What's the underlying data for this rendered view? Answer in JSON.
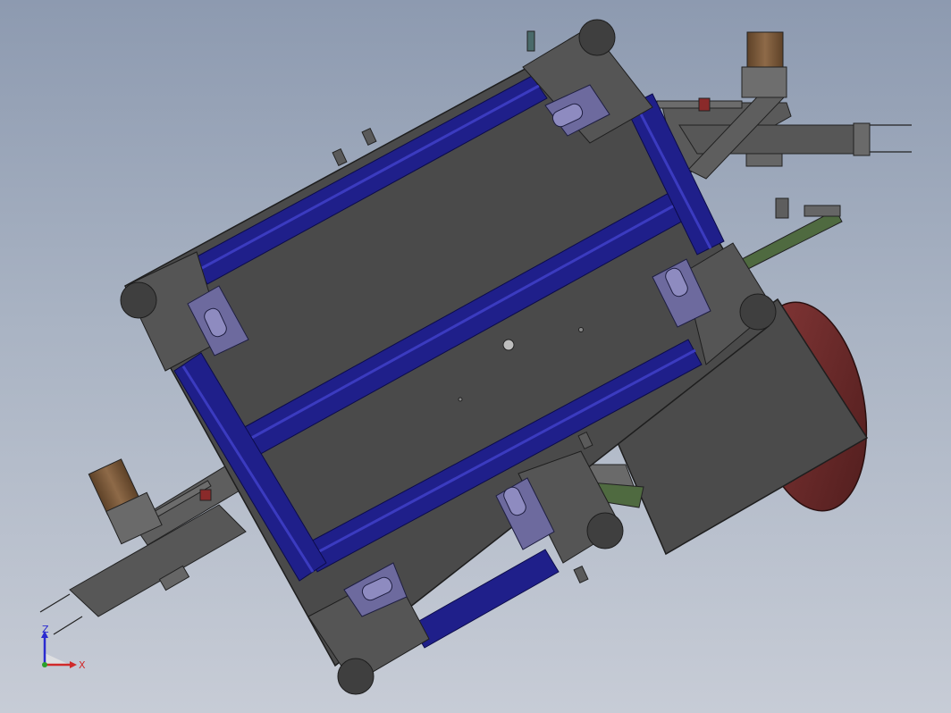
{
  "viewport": {
    "background_top": "#8d9ab0",
    "background_bottom": "#c7ccd6"
  },
  "colors": {
    "frame_blue": "#1f1f8a",
    "frame_blue_light": "#3b3bc0",
    "plate_gray": "#555555",
    "body_gray": "#4a4a4a",
    "bracket_gray": "#5e5e5e",
    "foot_gray": "#3f3f3f",
    "caster_purple": "#6d6a9e",
    "motor_brown": "#7a5a3c",
    "drum_red": "#6e2a2a",
    "rod_green": "#3d6a2f"
  },
  "triad": {
    "z_label": "Z",
    "x_label": "X",
    "z_color": "#2a2ad0",
    "x_color": "#d02a2a",
    "y_color": "#2aa02a"
  }
}
